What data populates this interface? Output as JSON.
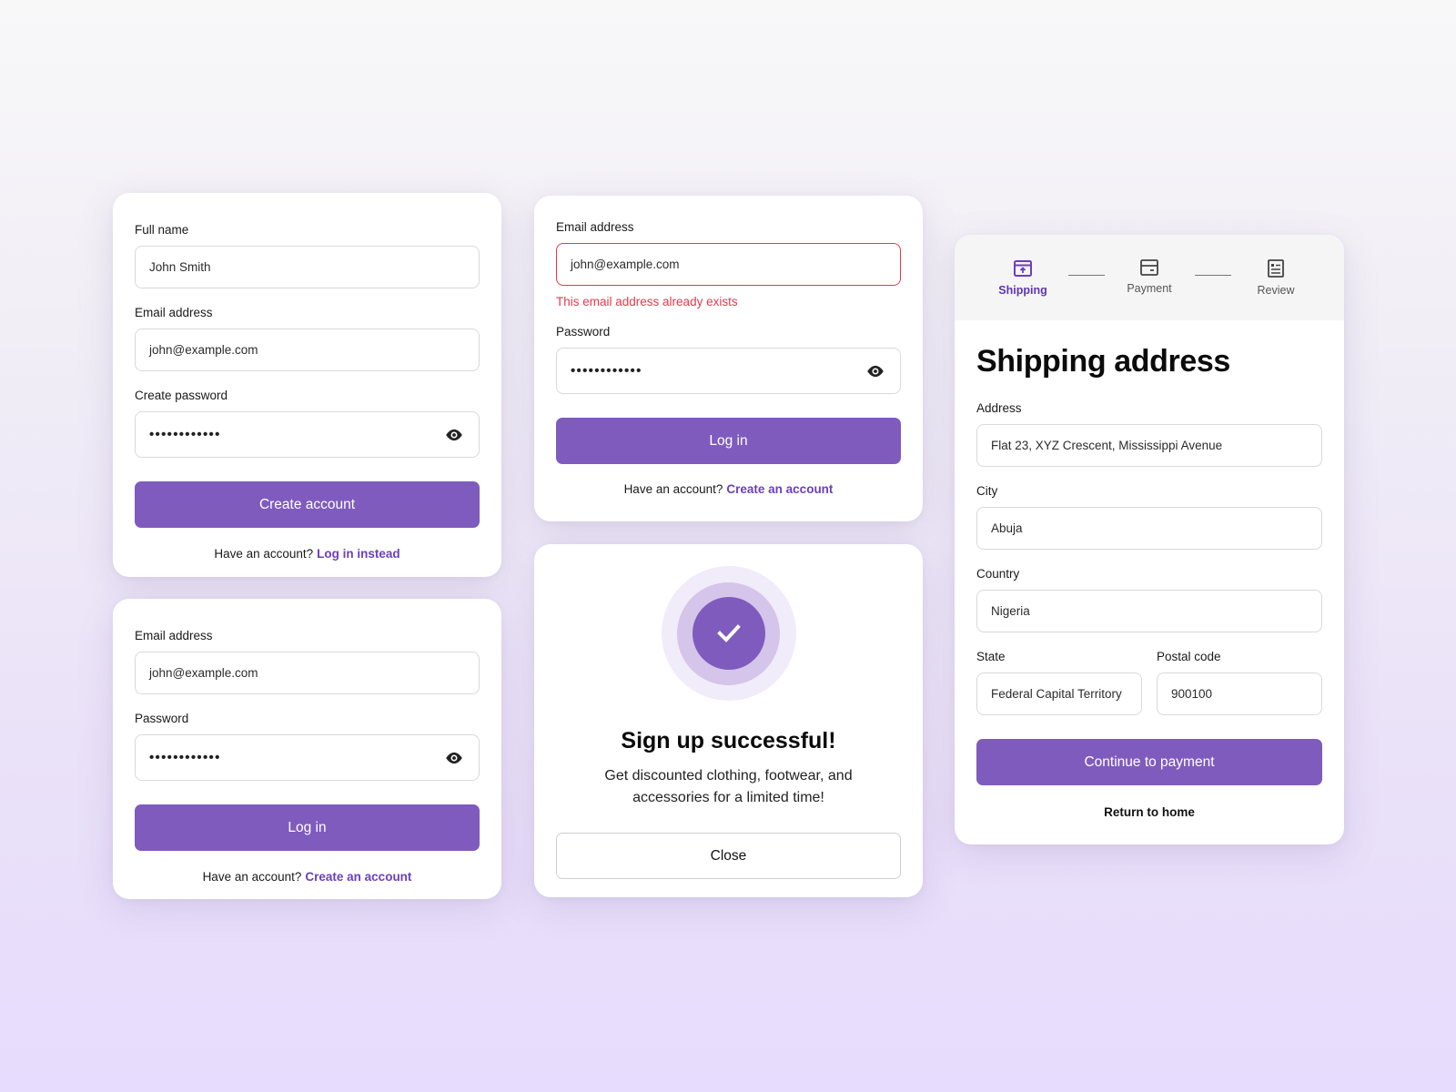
{
  "colors": {
    "accent": "#7f5bbe",
    "accent_text": "#6a3fbf",
    "error": "#e5394c",
    "ring_outer": "#f1ecf9",
    "ring_middle": "#d5c5ea"
  },
  "signup": {
    "full_name_label": "Full name",
    "full_name_value": "John Smith",
    "email_label": "Email address",
    "email_value": "john@example.com",
    "password_label": "Create password",
    "password_masked": "••••••••••••",
    "submit_label": "Create account",
    "footer_text": "Have an account?",
    "footer_link": "Log in instead"
  },
  "login_error": {
    "email_label": "Email address",
    "email_value": "john@example.com",
    "error_message": "This email address already exists",
    "password_label": "Password",
    "password_masked": "••••••••••••",
    "submit_label": "Log in",
    "footer_text": "Have an account?",
    "footer_link": "Create an account"
  },
  "login": {
    "email_label": "Email address",
    "email_value": "john@example.com",
    "password_label": "Password",
    "password_masked": "••••••••••••",
    "submit_label": "Log in",
    "footer_text": "Have an account?",
    "footer_link": "Create an account"
  },
  "success": {
    "icon": "check-icon",
    "title": "Sign up successful!",
    "message_line1": "Get discounted clothing, footwear, and",
    "message_line2": "accessories for a limited time!",
    "close_label": "Close"
  },
  "shipping": {
    "steps": [
      {
        "label": "Shipping",
        "icon": "box-upload-icon",
        "active": true
      },
      {
        "label": "Payment",
        "icon": "credit-card-icon",
        "active": false
      },
      {
        "label": "Review",
        "icon": "document-list-icon",
        "active": false
      }
    ],
    "title": "Shipping address",
    "address_label": "Address",
    "address_value": "Flat 23, XYZ Crescent, Mississippi Avenue",
    "city_label": "City",
    "city_value": "Abuja",
    "country_label": "Country",
    "country_value": "Nigeria",
    "state_label": "State",
    "state_value": "Federal Capital Territory",
    "postal_label": "Postal code",
    "postal_value": "900100",
    "continue_label": "Continue to payment",
    "return_label": "Return to home"
  }
}
